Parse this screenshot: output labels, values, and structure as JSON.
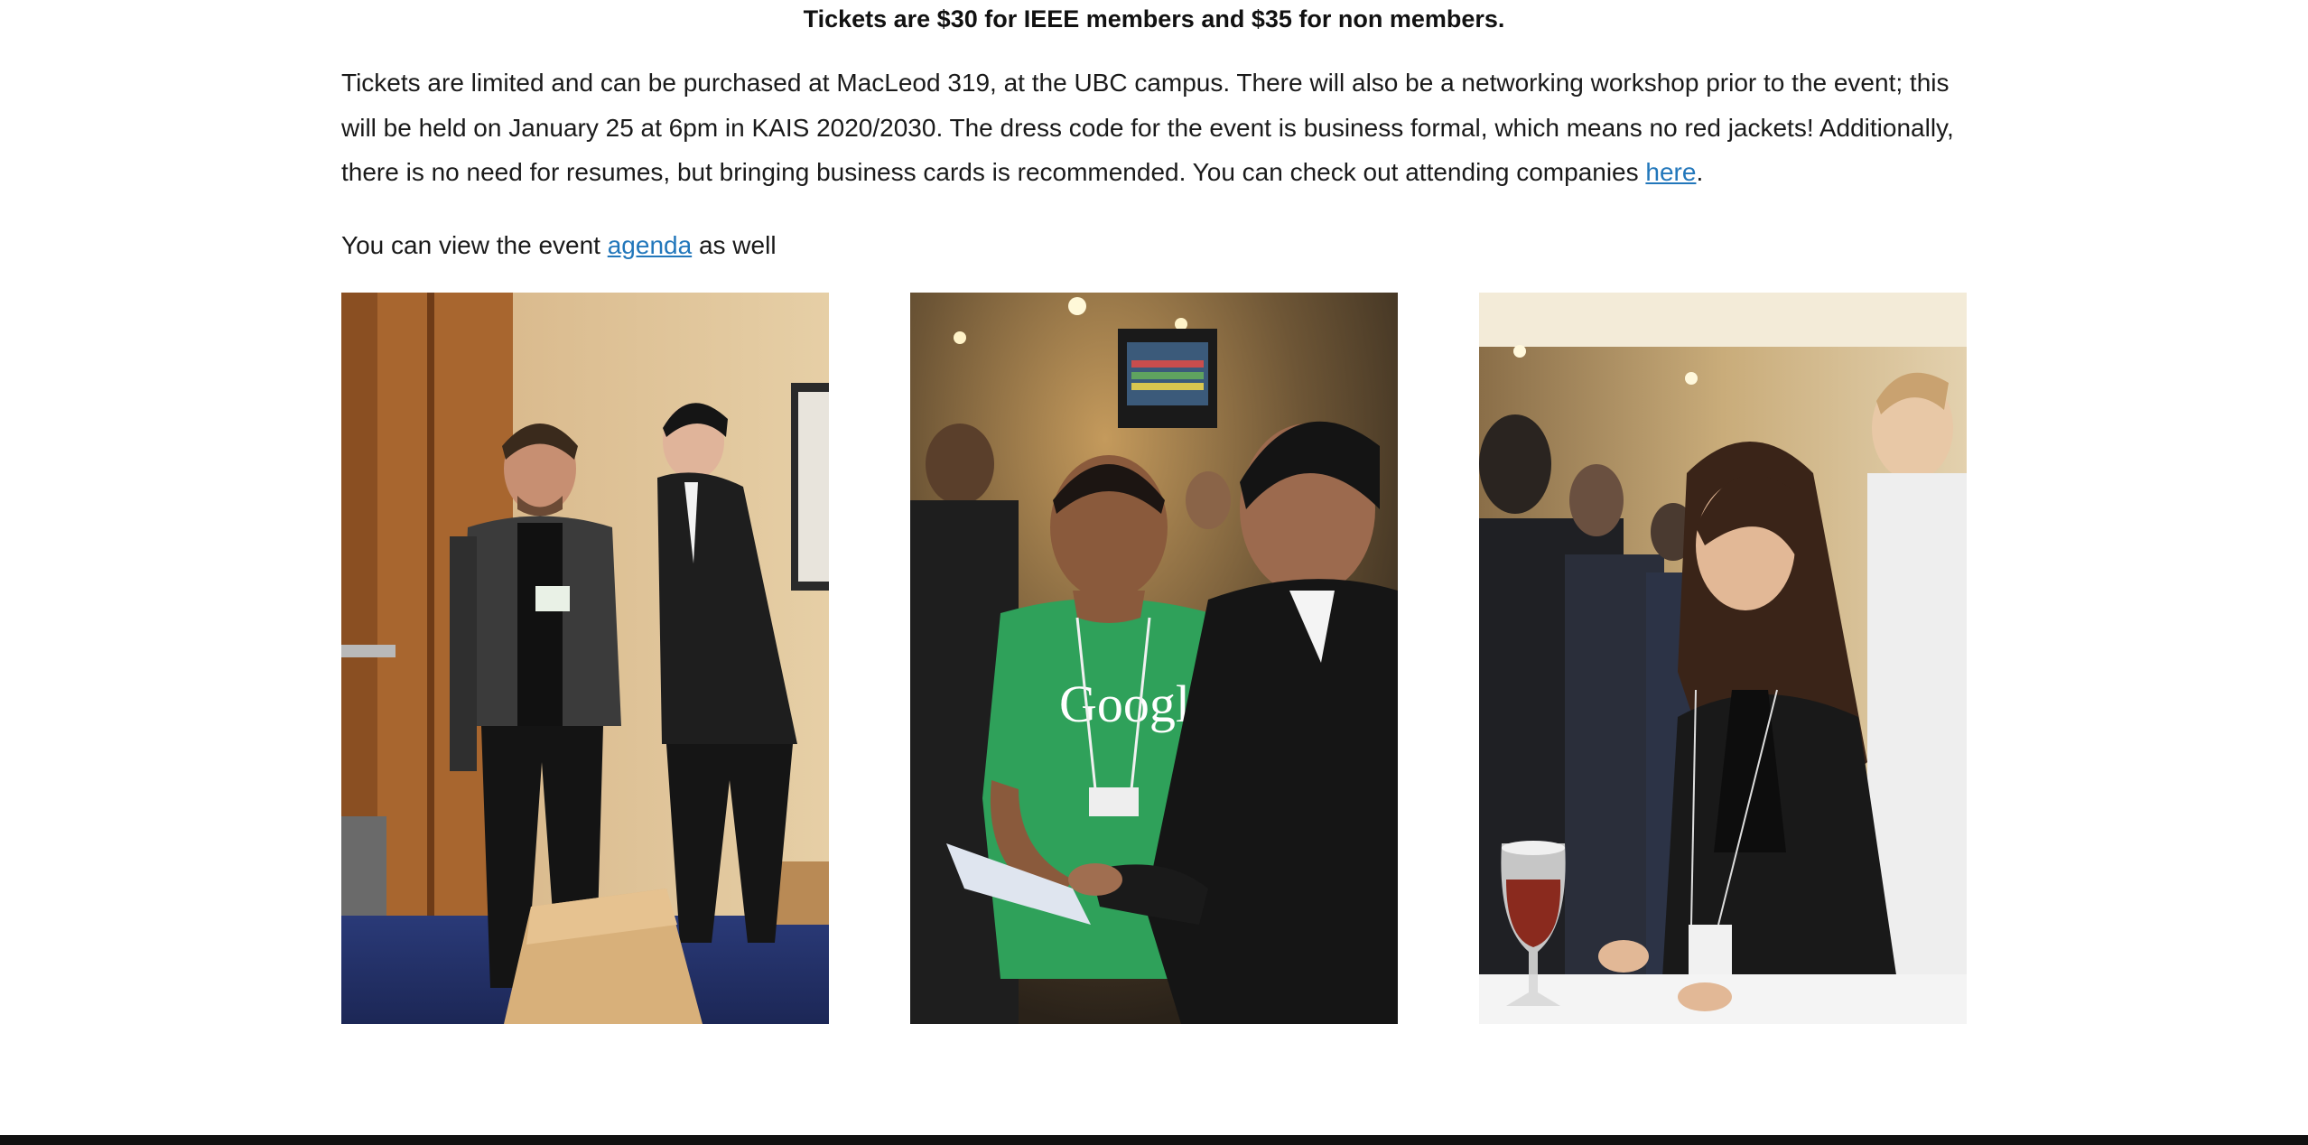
{
  "pricing": {
    "text": "Tickets are $30 for IEEE members and $35 for non members."
  },
  "details": {
    "text_before_link": "Tickets are limited and can be purchased at MacLeod 319, at the UBC campus. There will also be a networking workshop prior to the event; this will be held on January 25 at 6pm in KAIS 2020/2030. The dress code for the event is business formal, which means no red jackets! Additionally, there is no need for resumes, but bringing business cards is recommended. You can check out attending companies ",
    "link_label": "here",
    "text_after_link": "."
  },
  "agenda": {
    "text_before_link": "You can view the event ",
    "link_label": "agenda",
    "text_after_link": " as well"
  },
  "photos": [
    {
      "icon": "photo-two-men-talking"
    },
    {
      "icon": "photo-google-attendee"
    },
    {
      "icon": "photo-woman-with-drink"
    }
  ],
  "colors": {
    "link": "#2277bb",
    "text": "#1a1a1a",
    "footer": "#111111"
  }
}
